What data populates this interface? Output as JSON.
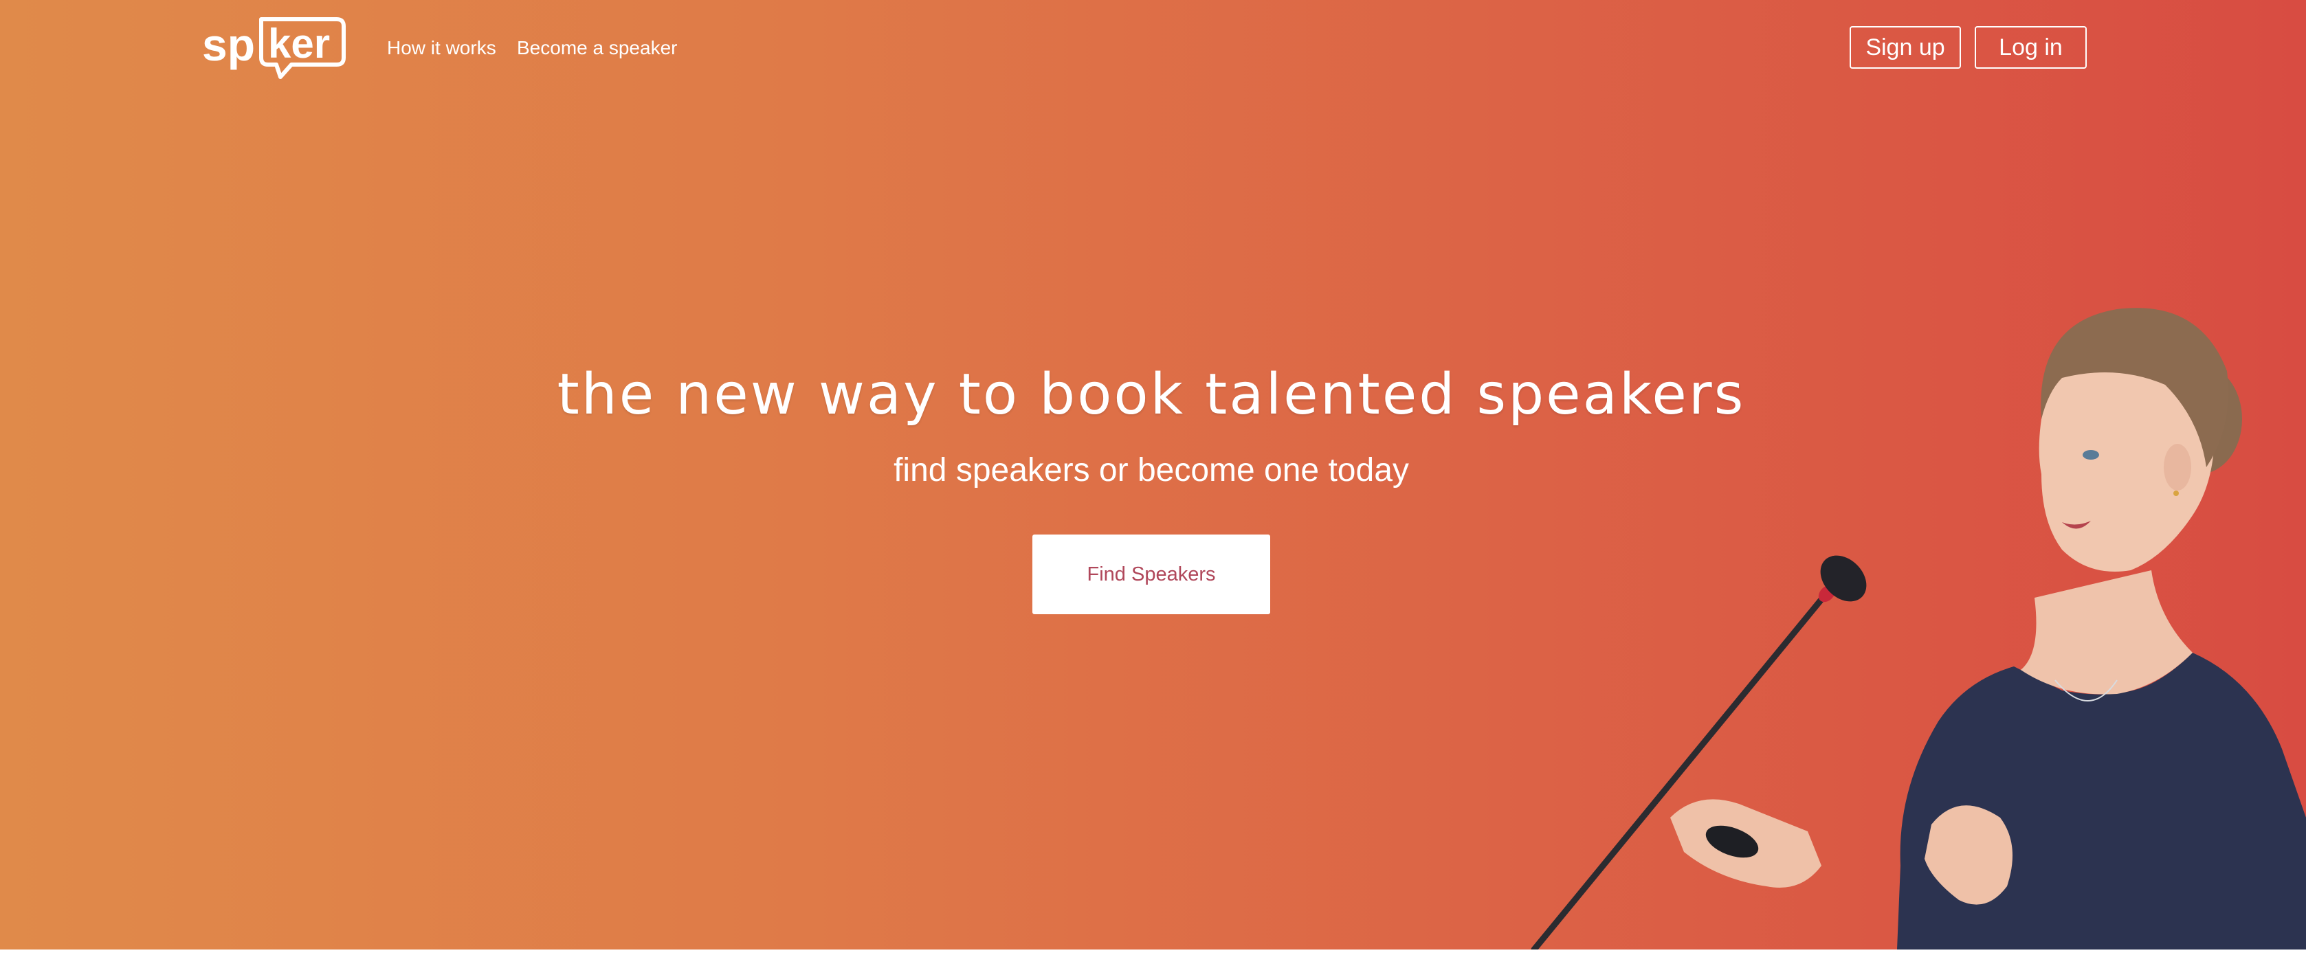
{
  "brand": {
    "logo_text_sp": "sp",
    "logo_text_ker": "ker"
  },
  "nav": {
    "links": [
      {
        "label": "How it works"
      },
      {
        "label": "Become a speaker"
      }
    ],
    "signup_label": "Sign up",
    "login_label": "Log in"
  },
  "hero": {
    "headline": "the new way to book talented speakers",
    "subheadline": "find speakers or become one today",
    "cta_label": "Find Speakers",
    "gradient_start": "#e08a4a",
    "gradient_end": "#d84c42",
    "cta_text_color": "#b0475a"
  },
  "illustration": {
    "subject": "woman speaking into microphone holding presentation clicker",
    "icons": [
      "microphone-icon"
    ]
  }
}
